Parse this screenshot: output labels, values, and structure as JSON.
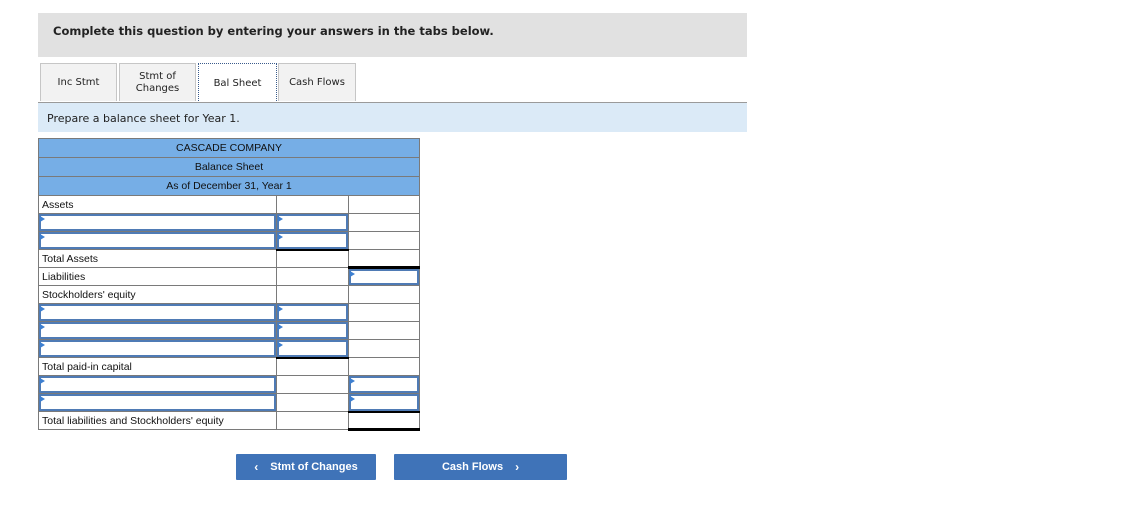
{
  "banner": {
    "text": "Complete this question by entering your answers in the tabs below."
  },
  "tabs": [
    {
      "label": "Inc Stmt",
      "active": false
    },
    {
      "label": "Stmt of Changes",
      "line1": "Stmt of",
      "line2": "Changes",
      "active": false
    },
    {
      "label": "Bal Sheet",
      "active": true
    },
    {
      "label": "Cash Flows",
      "active": false
    }
  ],
  "instruction": "Prepare a balance sheet for Year 1.",
  "sheet": {
    "company": "CASCADE COMPANY",
    "title": "Balance Sheet",
    "date": "As of December 31, Year 1",
    "rows": {
      "assets": "Assets",
      "total_assets": "Total Assets",
      "liabilities": "Liabilities",
      "equity": "Stockholders' equity",
      "total_paid_in": "Total paid-in capital",
      "total_le": "Total liabilities and Stockholders' equity"
    },
    "inputs": {
      "asset_1_label": "",
      "asset_1_amount": "",
      "asset_2_label": "",
      "asset_2_amount": "",
      "liabilities_amount": "",
      "equity_1_label": "",
      "equity_1_amount": "",
      "equity_2_label": "",
      "equity_2_amount": "",
      "equity_3_label": "",
      "equity_3_amount": "",
      "extra_1_label": "",
      "extra_1_amount": "",
      "extra_2_label": "",
      "extra_2_amount": ""
    }
  },
  "nav": {
    "prev": {
      "label": "Stmt of Changes",
      "icon": "‹"
    },
    "next": {
      "label": "Cash Flows",
      "icon": "›"
    }
  }
}
